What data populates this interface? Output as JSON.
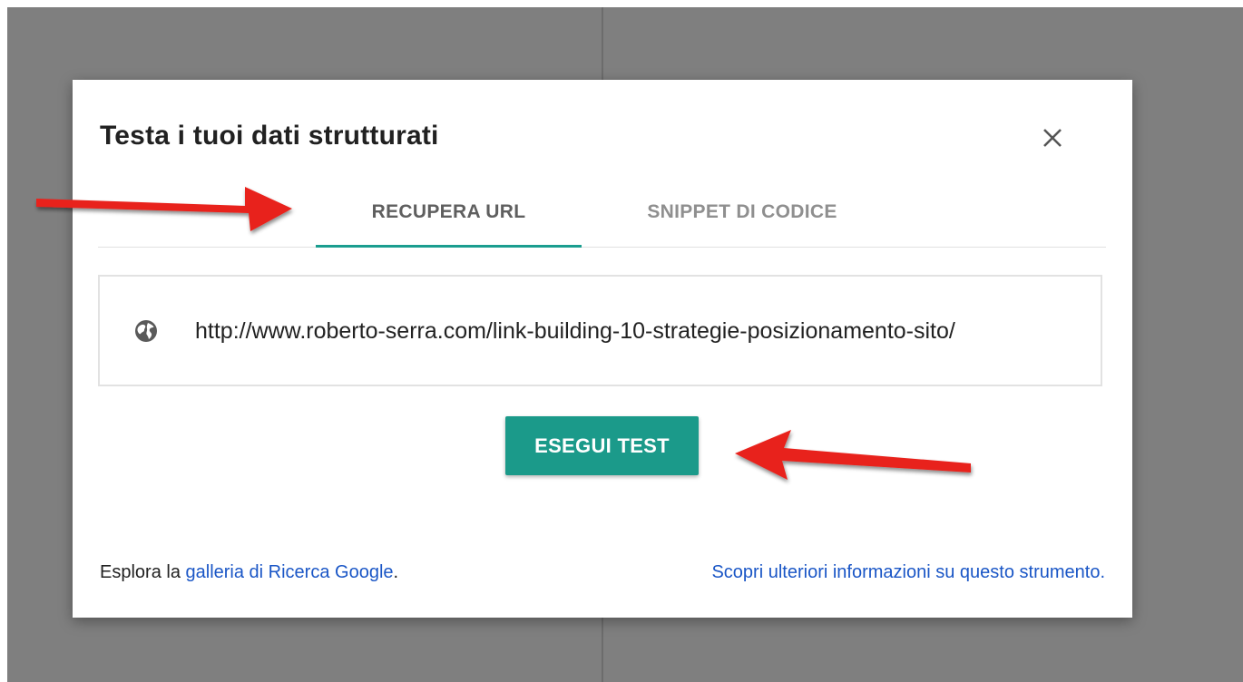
{
  "dialog": {
    "title": "Testa i tuoi dati strutturati",
    "close_icon": "close-icon"
  },
  "tabs": [
    {
      "label": "RECUPERA URL",
      "active": true
    },
    {
      "label": "SNIPPET DI CODICE",
      "active": false
    }
  ],
  "url_field": {
    "icon": "globe-icon",
    "value": "http://www.roberto-serra.com/link-building-10-strategie-posizionamento-sito/"
  },
  "run_button": {
    "label": "ESEGUI TEST"
  },
  "footer": {
    "left_prefix": "Esplora la ",
    "left_link": "galleria di Ricerca Google",
    "left_suffix": ".",
    "right_link": "Scopri ulteriori informazioni su questo strumento",
    "right_suffix": "."
  },
  "colors": {
    "accent": "#1b9a8a",
    "link": "#1a56c6",
    "annotation_arrow": "#e8241c",
    "backdrop": "#7f7f7f"
  }
}
